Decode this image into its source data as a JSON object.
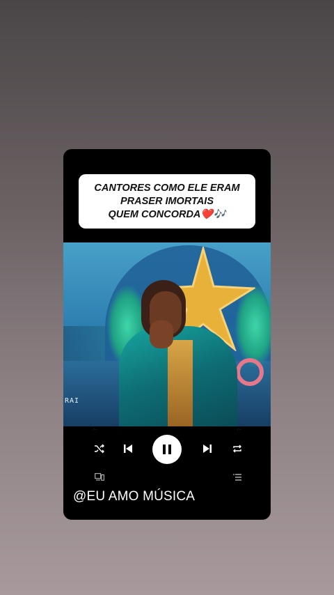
{
  "caption": {
    "lines": [
      "CANTORES COMO ELE ERAM",
      "PRASER IMORTAIS",
      "QUEM CONCORDA❤️🎶"
    ]
  },
  "video": {
    "watermark": "RAI"
  },
  "player": {
    "controls": [
      "shuffle-icon",
      "previous-icon",
      "pause-icon",
      "next-icon",
      "repeat-icon"
    ],
    "secondary": [
      "device-icon",
      "queue-icon"
    ]
  },
  "footer": {
    "handle": "@EU AMO MÚSICA"
  },
  "colors": {
    "card": "#000000",
    "caption_bg": "#ffffff",
    "accent": "#ffffff"
  }
}
